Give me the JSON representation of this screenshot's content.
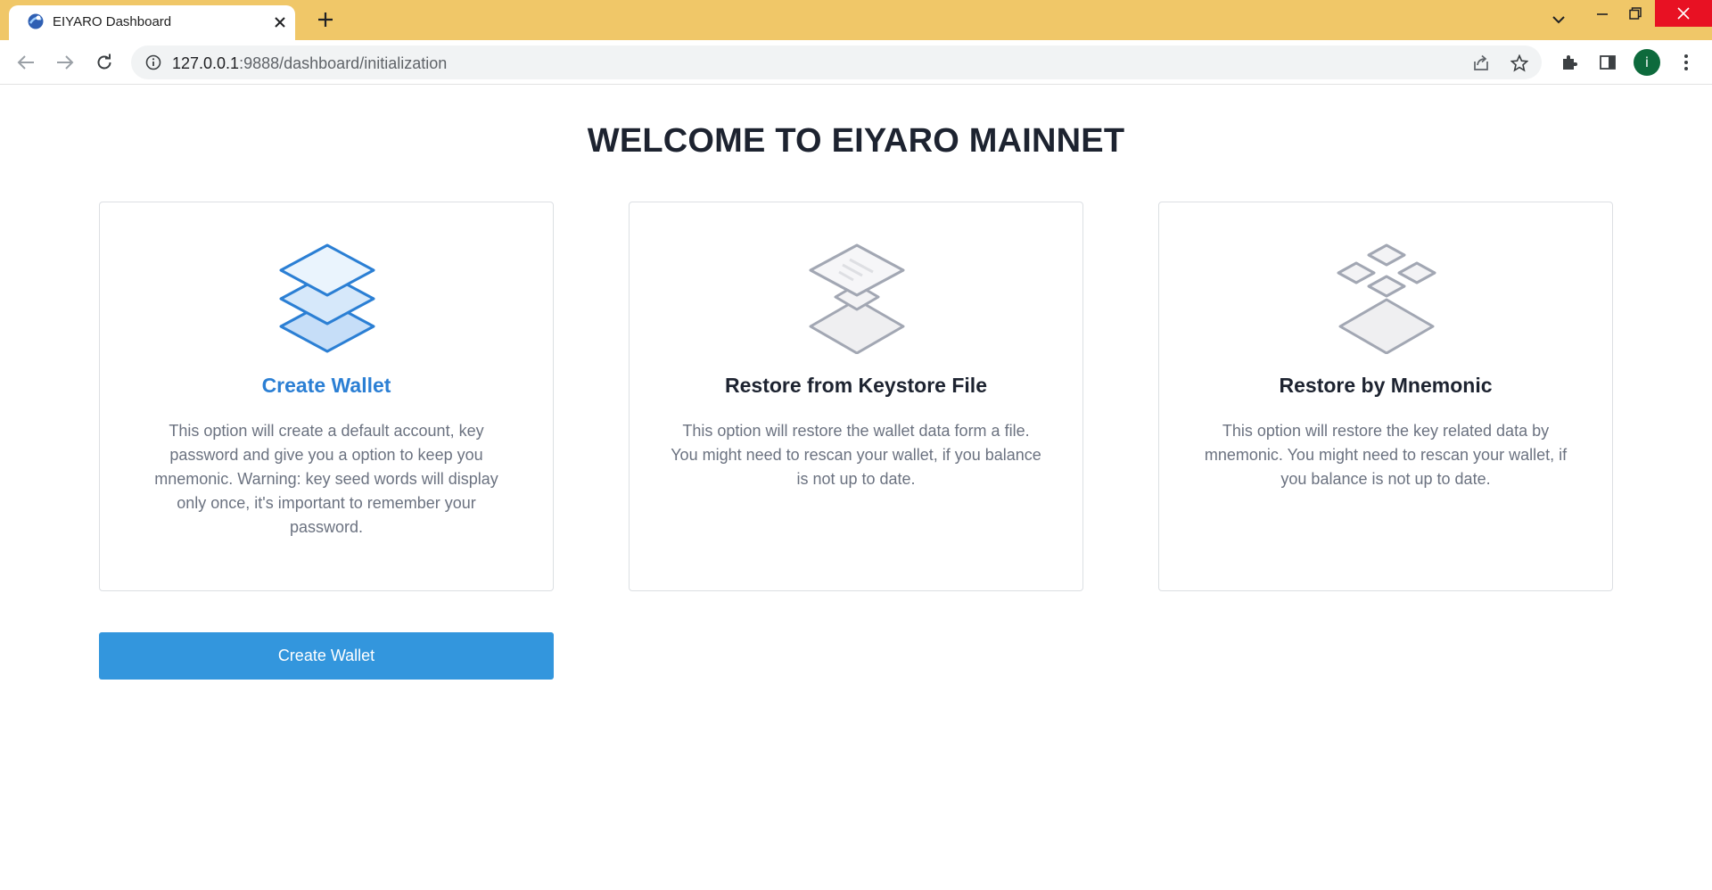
{
  "browser": {
    "tab_title": "EIYARO Dashboard",
    "url_host": "127.0.0.1",
    "url_rest": ":9888/dashboard/initialization",
    "profile_initial": "i",
    "theme_color": "#f0c768"
  },
  "page": {
    "title": "WELCOME TO EIYARO MAINNET"
  },
  "cards": [
    {
      "title": "Create Wallet",
      "description": "This option will create a default account, key password and give you a option to keep you mnemonic. Warning: key seed words will display only once, it's important to remember your password.",
      "icon": "layers-stack-icon",
      "selected": true
    },
    {
      "title": "Restore from Keystore File",
      "description": "This option will restore the wallet data form a file. You might need to rescan your wallet, if you balance is not up to date.",
      "icon": "keystore-file-icon",
      "selected": false
    },
    {
      "title": "Restore by Mnemonic",
      "description": "This option will restore the key related data by mnemonic. You might need to rescan your wallet, if you balance is not up to date.",
      "icon": "mnemonic-diamonds-icon",
      "selected": false
    }
  ],
  "actions": {
    "primary_label": "Create Wallet",
    "accent_color": "#3396dd"
  }
}
